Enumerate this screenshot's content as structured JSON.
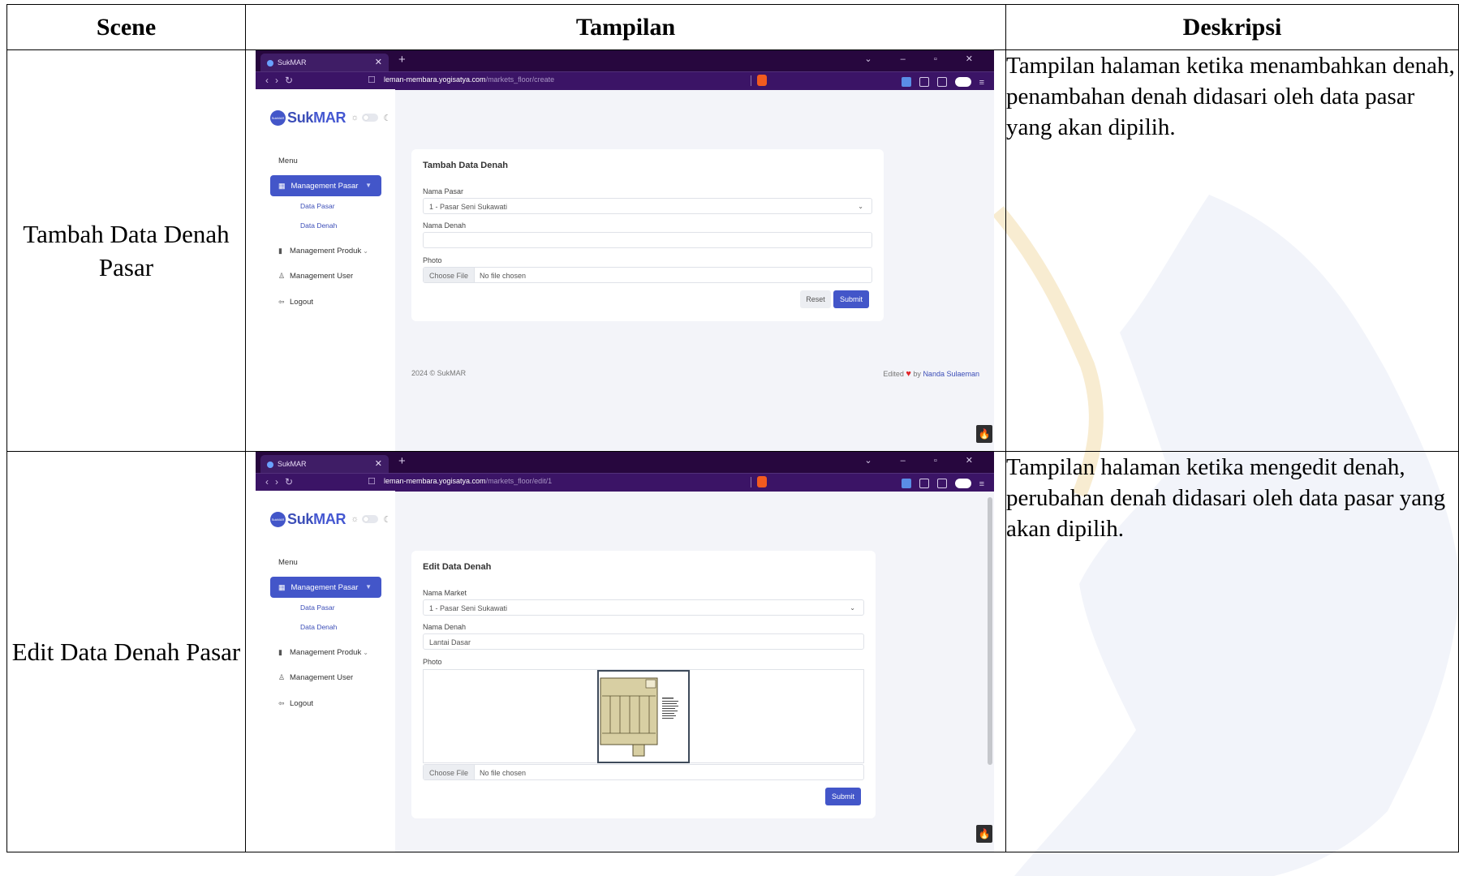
{
  "table": {
    "headers": [
      "Scene",
      "Tampilan",
      "Deskripsi"
    ],
    "rows": [
      {
        "scene": "Tambah Data Denah Pasar",
        "description": "Tampilan halaman ketika menambahkan denah, penambahan denah didasari oleh data pasar yang akan dipilih."
      },
      {
        "scene": "Edit Data Denah Pasar",
        "description": "Tampilan halaman ketika mengedit denah, perubahan denah didasari oleh data pasar yang akan dipilih."
      }
    ]
  },
  "browser": {
    "tab_title": "SukMAR",
    "url_domain": "leman-membara.yogisatya.com",
    "url_path_create": "/markets_floor/create",
    "url_path_edit": "/markets_floor/edit/1"
  },
  "sidebar": {
    "logo_prefix": "Suk",
    "logo_suffix": "MAR",
    "logo_badge": "SukMAR",
    "menu_title": "Menu",
    "active_item": "Management Pasar",
    "submenu": [
      "Data Pasar",
      "Data Denah"
    ],
    "items": [
      "Management Produk",
      "Management User",
      "Logout"
    ]
  },
  "create_form": {
    "title": "Tambah Data Denah",
    "market_label": "Nama Pasar",
    "market_value": "1 - Pasar Seni Sukawati",
    "floor_label": "Nama Denah",
    "floor_value": "",
    "photo_label": "Photo",
    "choose_file": "Choose File",
    "no_file": "No file chosen",
    "reset": "Reset",
    "submit": "Submit"
  },
  "edit_form": {
    "title": "Edit Data Denah",
    "market_label": "Nama Market",
    "market_value": "1 - Pasar Seni Sukawati",
    "floor_label": "Nama Denah",
    "floor_value": "Lantai Dasar",
    "photo_label": "Photo",
    "choose_file": "Choose File",
    "no_file": "No file chosen",
    "submit": "Submit"
  },
  "footer": {
    "copyright": "2024 © SukMAR",
    "edited": "Edited",
    "by": "by",
    "author": "Nanda Sulaeman"
  },
  "icons": {
    "brand": "#4356c9",
    "heart": "#e1252a",
    "flame": "#ff6a2b",
    "browser_bar": "#27073e"
  }
}
